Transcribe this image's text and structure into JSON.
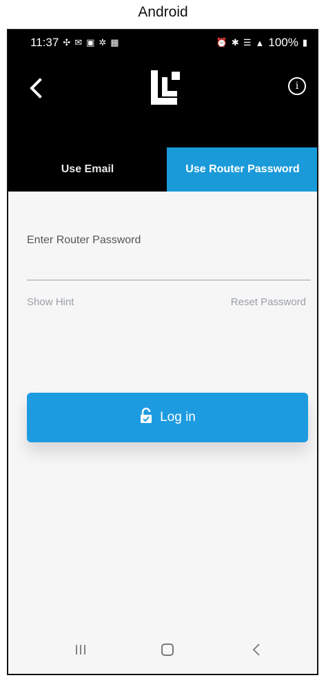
{
  "caption": "Android",
  "status_bar": {
    "time": "11:37",
    "battery": "100%",
    "left_icons": [
      "grid-icon",
      "message-icon",
      "app-icon",
      "pinwheel-icon",
      "calendar-icon"
    ],
    "right_icons": [
      "alarm-icon",
      "bluetooth-icon",
      "wifi-icon",
      "signal-icon",
      "battery-icon"
    ]
  },
  "header": {
    "back_icon": "chevron-left-icon",
    "logo": "linksys-velop-logo",
    "info_icon": "info-icon"
  },
  "tabs": [
    {
      "label": "Use Email",
      "active": false
    },
    {
      "label": "Use Router Password",
      "active": true
    }
  ],
  "form": {
    "password_label": "Enter Router Password",
    "password_value": "",
    "show_hint_label": "Show Hint",
    "reset_password_label": "Reset Password",
    "login_label": "Log in",
    "login_icon": "unlock-icon"
  },
  "colors": {
    "accent": "#1d9be1",
    "header_bg": "#000000",
    "content_bg": "#f6f6f7"
  },
  "system_nav": [
    "recents-icon",
    "home-icon",
    "back-icon"
  ]
}
